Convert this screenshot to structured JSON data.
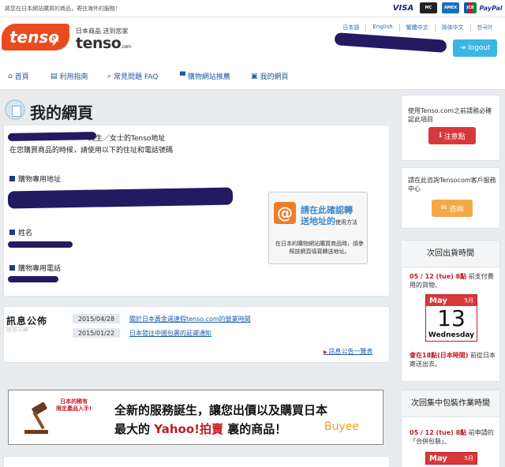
{
  "topbar": {
    "message": "將您在日本網站購買的商品，寄往海外的服務！",
    "cards": [
      "VISA",
      "MasterCard",
      "AMERICAN EXPRESS",
      "JCB",
      "PayPal"
    ]
  },
  "header": {
    "logo_text": "tenso",
    "tagline": "日本商品 送到您家",
    "brand": "tenso",
    "brand_suffix": ".com",
    "languages": [
      "日本語",
      "English",
      "繁體中文",
      "简体中文",
      "한국어"
    ],
    "active_language": "繁體中文",
    "logout_label": "logout"
  },
  "nav": {
    "items": [
      {
        "icon": "home-icon",
        "label": "首頁"
      },
      {
        "icon": "book-icon",
        "label": "利用指南"
      },
      {
        "icon": "search-icon",
        "label": "常見問題 FAQ"
      },
      {
        "icon": "cart-icon",
        "label": "購物網站推薦"
      },
      {
        "icon": "user-card-icon",
        "label": "我的網頁"
      }
    ]
  },
  "page": {
    "title": "我的網頁"
  },
  "address_panel": {
    "title": "先生／女士的Tenso地址",
    "subtitle": "在您購買商品的時候，請使用以下的住址和電話號碼",
    "shipping_address_label": "購物專用地址",
    "name_label": "姓名",
    "phone_label": "購物專用電話",
    "confirm": {
      "icon": "@",
      "heading_1": "請在此確認轉",
      "heading_2": "送地址的",
      "heading_suffix": "使用方法",
      "note": "在日本的購物網站購買商品時，請參照該網頁填寫轉送地址。"
    }
  },
  "news": {
    "title": "訊息公佈",
    "title_reflection": "訊息公佈",
    "items": [
      {
        "date": "2015/04/28",
        "text": "關於日本黃金週連假tenso.com的營業時間"
      },
      {
        "date": "2015/01/22",
        "text": "日本發往中國包裹的延遲通知"
      }
    ],
    "more_label": "訊息公告一覽表"
  },
  "banner": {
    "ribbon_1": "日本的稀有",
    "ribbon_2": "限定產品入手!",
    "line1": "全新的服務誕生，讓您出價以及購買日本",
    "line2_prefix": "最大的 ",
    "line2_yahoo": "Yahoo!拍賣",
    "line2_suffix": " 裏的商品！",
    "buyee": "Buyee"
  },
  "sidebar": {
    "notice_text": "使用Tenso.com之前請務必確認此項目",
    "notice_button": "注意點",
    "contact_text": "請在此咨詢Tensocom客戶服務中心",
    "contact_button": "咨詢",
    "next_ship": {
      "title": "次回出貨時間",
      "line1_red": "05 / 12 (tue) 8點",
      "line1_rest": " 前支付費用的貨物、",
      "cal_month": "May",
      "cal_month_num": "5月",
      "cal_day": "13",
      "cal_weekday": "Wednesday",
      "line2_red": "會在18點(日本時間)",
      "line2_rest": " 前從日本寄送出去。"
    },
    "next_pack": {
      "title": "次回集中包裝作業時間",
      "line1_red": "05 / 12 (tue) 8點",
      "line1_rest": " 前申請的「合併包裝」、",
      "cal_month": "May",
      "cal_month_num": "5月"
    }
  }
}
